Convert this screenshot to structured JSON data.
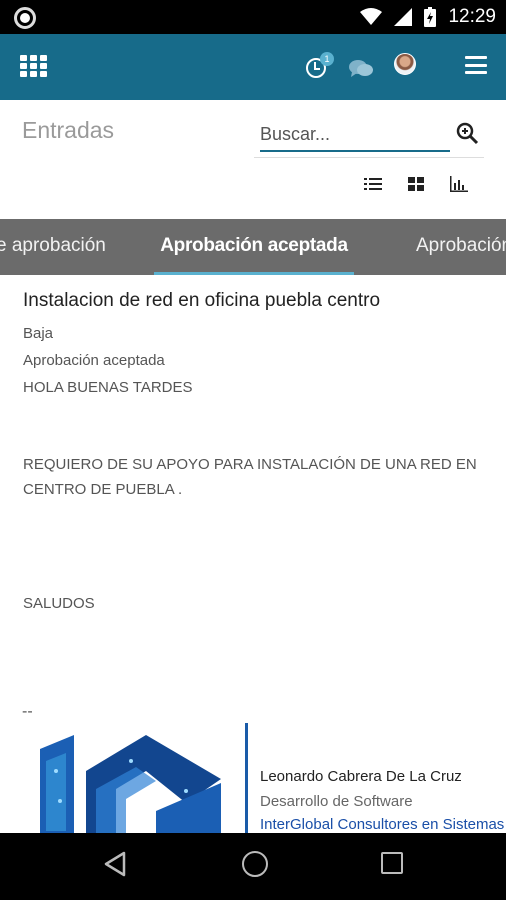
{
  "status_bar": {
    "time": "12:29"
  },
  "app_bar": {
    "notification_count": "1"
  },
  "header": {
    "title": "Entradas",
    "search_placeholder": "Buscar..."
  },
  "tabs": [
    {
      "label": "e aprobación",
      "active": false
    },
    {
      "label": "Aprobación aceptada",
      "active": true
    },
    {
      "label": "Aprobación",
      "active": false
    }
  ],
  "entry": {
    "title": "Instalacion de red en oficina puebla centro",
    "priority": "Baja",
    "status": "Aprobación aceptada",
    "greeting": "HOLA BUENAS TARDES",
    "request": "REQUIERO DE SU APOYO PARA INSTALACIÓN DE UNA RED EN\nCENTRO DE PUEBLA .",
    "closing": "SALUDOS"
  },
  "signature": {
    "separator": "--",
    "name": "Leonardo Cabrera De La Cruz",
    "role": "Desarrollo de Software",
    "company": "InterGlobal Consultores en Sistemas"
  },
  "colors": {
    "app_bar": "#176b8a",
    "tab_bar": "#6b6b6b",
    "tab_indicator": "#5ab1cf",
    "company_link": "#1a4fa8"
  },
  "icons": [
    "apps-grid-icon",
    "clock-icon",
    "chat-icon",
    "avatar",
    "menu-icon",
    "search-icon",
    "list-view-icon",
    "grid-view-icon",
    "chart-view-icon",
    "back-icon",
    "home-icon",
    "recent-apps-icon"
  ]
}
